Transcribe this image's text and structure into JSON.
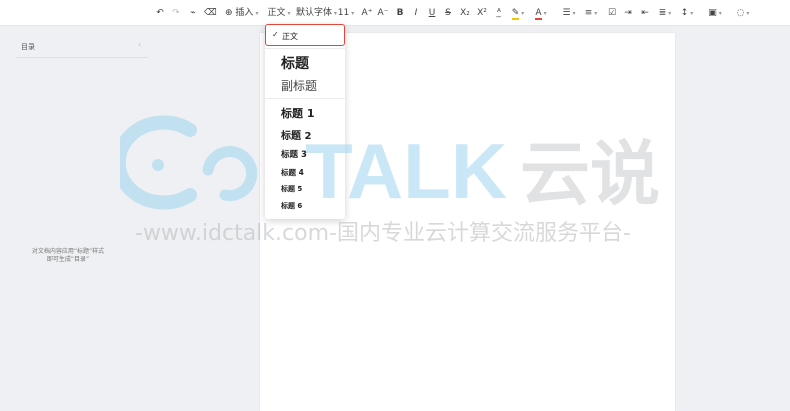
{
  "toolbar": {
    "insert_label": "插入",
    "style_label": "正文",
    "font_label": "默认字体",
    "size_label": "11",
    "bold_label": "B",
    "italic_label": "I",
    "underline_label": "U",
    "strike_label": "S",
    "subscript_label": "X₂",
    "superscript_label": "X²",
    "font_grow_label": "A⁺",
    "font_shrink_label": "A⁻",
    "font_color_label": "A",
    "highlight_color": "#f5c400",
    "font_color": "#e2453c"
  },
  "sidebar": {
    "toc_title": "目录",
    "hint_line1": "对文档内容应用“标题”样式",
    "hint_line2": "即可生成“目录”"
  },
  "style_menu": {
    "items": [
      {
        "label": "正文",
        "selected": true
      },
      {
        "label": "标题"
      },
      {
        "label": "副标题"
      },
      {
        "label": "标题 1"
      },
      {
        "label": "标题 2"
      },
      {
        "label": "标题 3"
      },
      {
        "label": "标题 4"
      },
      {
        "label": "标题 5"
      },
      {
        "label": "标题 6"
      }
    ]
  },
  "watermark": {
    "brand": "TALK",
    "cn": "云说",
    "url_line": "-www.idctalk.com-国内专业云计算交流服务平台-"
  },
  "colors": {
    "selection_border": "#e2453c",
    "watermark_blue": "#9ed4ef",
    "watermark_gray": "#c9cbcd"
  }
}
